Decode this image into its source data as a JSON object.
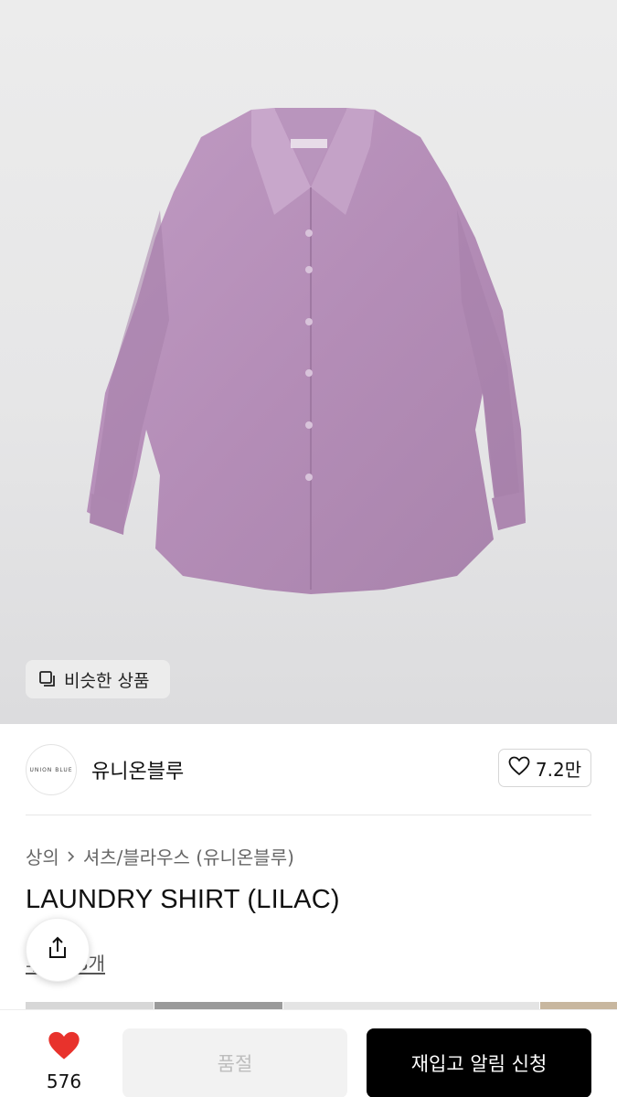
{
  "product_image": {
    "alt_icon": "lilac-shirt-image",
    "similar_chip_label": "비슷한 상품",
    "similar_icon": "similar-items-icon"
  },
  "brand": {
    "logo_text": "UNION BLUE",
    "name": "유니온블루",
    "like_count": "7.2만",
    "like_icon": "heart-outline-icon"
  },
  "breadcrumb": {
    "category": "상의",
    "separator_icon": "chevron-right-icon",
    "subcategory": "셔츠/블라우스 (유니온블루)"
  },
  "product": {
    "title": "LAUNDRY SHIRT (LILAC)",
    "review_text": "후기 58개"
  },
  "share": {
    "icon": "share-icon"
  },
  "bottom_bar": {
    "heart_icon": "heart-filled-icon",
    "heart_count": "576",
    "soldout_label": "품절",
    "restock_label": "재입고 알림 신청"
  },
  "colors": {
    "shirt": "#b58fb8",
    "heart_red": "#e8322c",
    "primary_button": "#000000",
    "disabled_button": "#f2f2f2"
  }
}
